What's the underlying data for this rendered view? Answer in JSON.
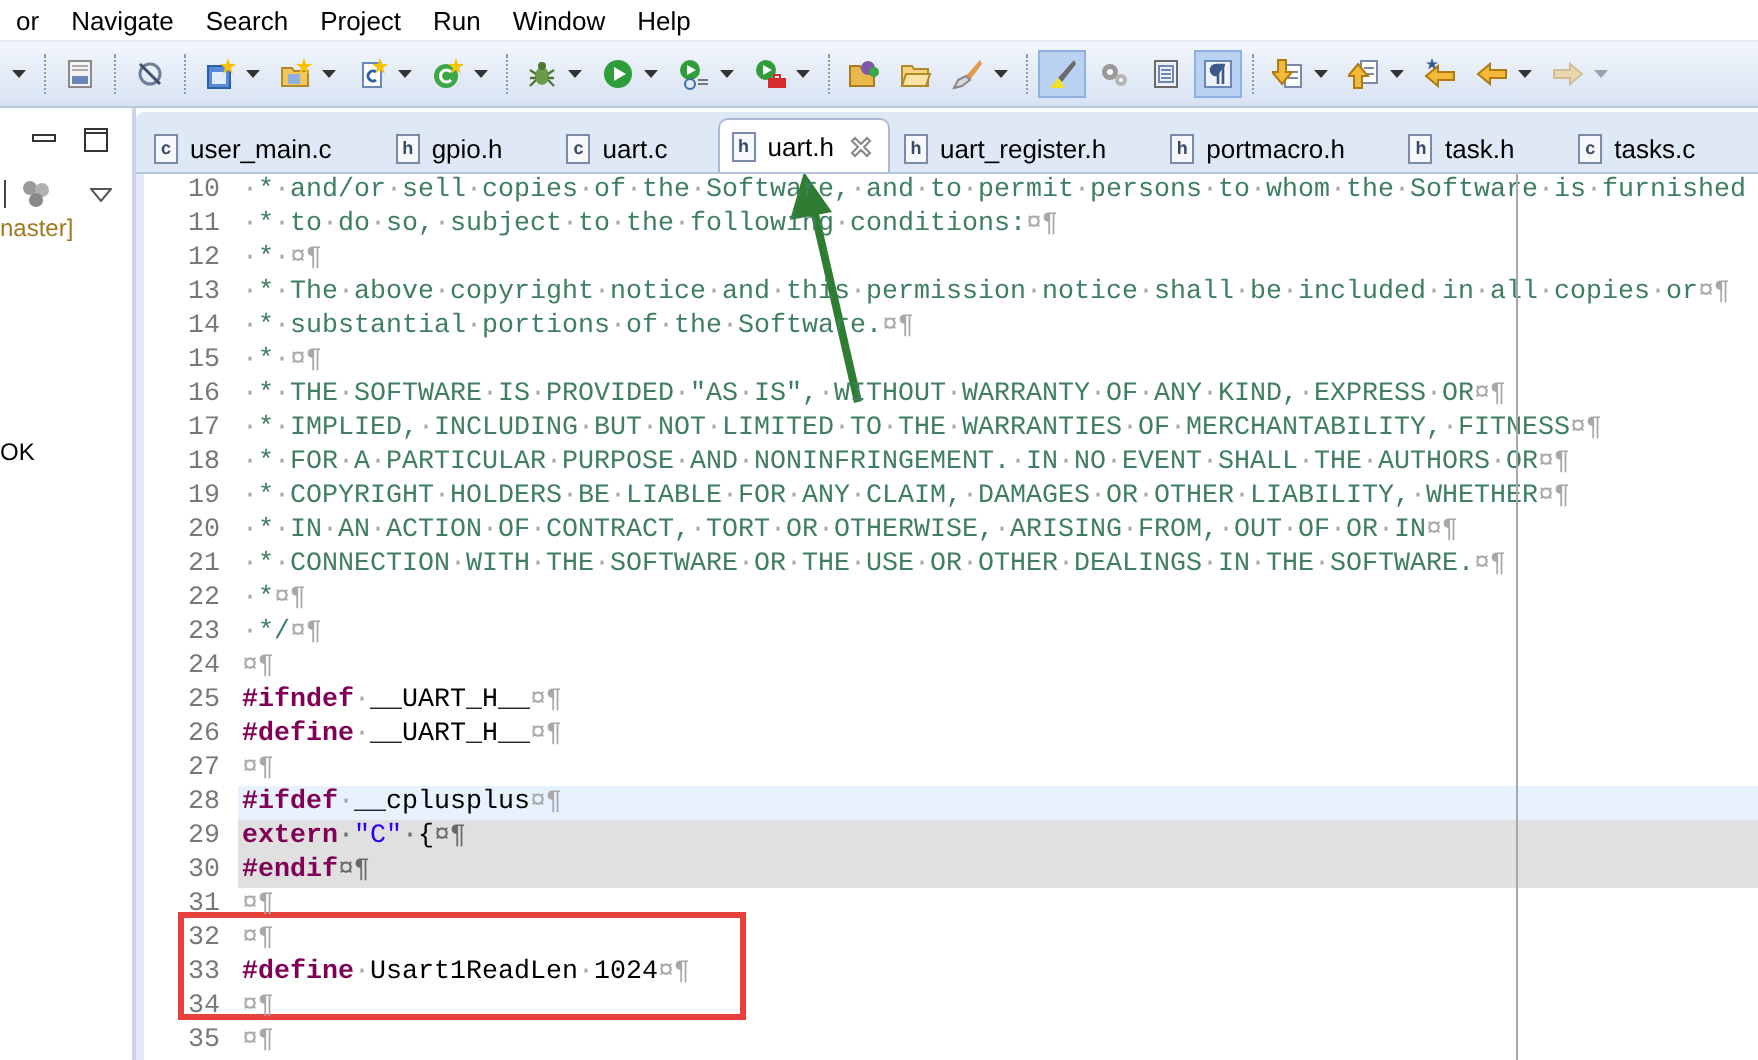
{
  "menu": [
    "or",
    "Navigate",
    "Search",
    "Project",
    "Run",
    "Window",
    "Help"
  ],
  "toolbar": [
    {
      "kind": "partial",
      "dropdown": true,
      "on": false,
      "disabled": false
    },
    {
      "kind": "sep"
    },
    {
      "kind": "binary",
      "dropdown": false,
      "on": false,
      "disabled": false
    },
    {
      "kind": "sep"
    },
    {
      "kind": "skip",
      "dropdown": false,
      "on": false,
      "disabled": false
    },
    {
      "kind": "sep"
    },
    {
      "kind": "newproject",
      "dropdown": true,
      "on": false,
      "disabled": false
    },
    {
      "kind": "newfolder",
      "dropdown": true,
      "on": false,
      "disabled": false
    },
    {
      "kind": "newfile",
      "dropdown": true,
      "on": false,
      "disabled": false
    },
    {
      "kind": "newclass",
      "dropdown": true,
      "on": false,
      "disabled": false
    },
    {
      "kind": "sep"
    },
    {
      "kind": "debug",
      "dropdown": true,
      "on": false,
      "disabled": false
    },
    {
      "kind": "run",
      "dropdown": true,
      "on": false,
      "disabled": false
    },
    {
      "kind": "coverage",
      "dropdown": true,
      "on": false,
      "disabled": false
    },
    {
      "kind": "tools",
      "dropdown": true,
      "on": false,
      "disabled": false
    },
    {
      "kind": "sep"
    },
    {
      "kind": "openfolder",
      "dropdown": false,
      "on": false,
      "disabled": false
    },
    {
      "kind": "folder",
      "dropdown": false,
      "on": false,
      "disabled": false
    },
    {
      "kind": "brush",
      "dropdown": true,
      "on": false,
      "disabled": false
    },
    {
      "kind": "sep"
    },
    {
      "kind": "highlight",
      "dropdown": false,
      "on": true,
      "disabled": false
    },
    {
      "kind": "blocks",
      "dropdown": false,
      "on": false,
      "disabled": false
    },
    {
      "kind": "outline",
      "dropdown": false,
      "on": false,
      "disabled": false
    },
    {
      "kind": "whitespace",
      "dropdown": false,
      "on": true,
      "disabled": false
    },
    {
      "kind": "sep"
    },
    {
      "kind": "nextann",
      "dropdown": true,
      "on": false,
      "disabled": false
    },
    {
      "kind": "prevann",
      "dropdown": true,
      "on": false,
      "disabled": false
    },
    {
      "kind": "lastedit",
      "dropdown": false,
      "on": false,
      "disabled": false
    },
    {
      "kind": "back",
      "dropdown": true,
      "on": false,
      "disabled": false
    },
    {
      "kind": "forward",
      "dropdown": true,
      "on": false,
      "disabled": true
    }
  ],
  "left_panel": {
    "texts": [
      {
        "kind": "branch",
        "text": "naster]"
      },
      {
        "kind": "plain",
        "text": "OK"
      }
    ]
  },
  "tabs": [
    {
      "icon_text": "c",
      "label": "user_main.c",
      "selected": false
    },
    {
      "icon_text": "h",
      "label": "gpio.h",
      "selected": false
    },
    {
      "icon_text": "c",
      "label": "uart.c",
      "selected": false
    },
    {
      "icon_text": "h",
      "label": "uart.h",
      "selected": true
    },
    {
      "icon_text": "h",
      "label": "uart_register.h",
      "selected": false
    },
    {
      "icon_text": "h",
      "label": "portmacro.h",
      "selected": false
    },
    {
      "icon_text": "h",
      "label": "task.h",
      "selected": false
    },
    {
      "icon_text": "c",
      "label": "tasks.c",
      "selected": false
    }
  ],
  "editor": {
    "lines": [
      {
        "number": "10",
        "current": false,
        "inactive": false,
        "segments": [
          {
            "kind": "comment",
            "text": "·*·and/or·sell·copies·of·the·Software,·and·to·permit·persons·to·whom·the·Software·is·furnished"
          }
        ]
      },
      {
        "number": "11",
        "current": false,
        "inactive": false,
        "segments": [
          {
            "kind": "comment",
            "text": "·*·to·do·so,·subject·to·the·following·conditions:¤¶"
          }
        ]
      },
      {
        "number": "12",
        "current": false,
        "inactive": false,
        "segments": [
          {
            "kind": "comment",
            "text": "·*·¤¶"
          }
        ]
      },
      {
        "number": "13",
        "current": false,
        "inactive": false,
        "segments": [
          {
            "kind": "comment",
            "text": "·*·The·above·copyright·notice·and·this·permission·notice·shall·be·included·in·all·copies·or¤¶"
          }
        ]
      },
      {
        "number": "14",
        "current": false,
        "inactive": false,
        "segments": [
          {
            "kind": "comment",
            "text": "·*·substantial·portions·of·the·Software.¤¶"
          }
        ]
      },
      {
        "number": "15",
        "current": false,
        "inactive": false,
        "segments": [
          {
            "kind": "comment",
            "text": "·*·¤¶"
          }
        ]
      },
      {
        "number": "16",
        "current": false,
        "inactive": false,
        "segments": [
          {
            "kind": "comment",
            "text": "·*·THE·SOFTWARE·IS·PROVIDED·\"AS·IS\",·WITHOUT·WARRANTY·OF·ANY·KIND,·EXPRESS·OR¤¶"
          }
        ]
      },
      {
        "number": "17",
        "current": false,
        "inactive": false,
        "segments": [
          {
            "kind": "comment",
            "text": "·*·IMPLIED,·INCLUDING·BUT·NOT·LIMITED·TO·THE·WARRANTIES·OF·MERCHANTABILITY,·FITNESS¤¶"
          }
        ]
      },
      {
        "number": "18",
        "current": false,
        "inactive": false,
        "segments": [
          {
            "kind": "comment",
            "text": "·*·FOR·A·PARTICULAR·PURPOSE·AND·NONINFRINGEMENT.·IN·NO·EVENT·SHALL·THE·AUTHORS·OR¤¶"
          }
        ]
      },
      {
        "number": "19",
        "current": false,
        "inactive": false,
        "segments": [
          {
            "kind": "comment",
            "text": "·*·COPYRIGHT·HOLDERS·BE·LIABLE·FOR·ANY·CLAIM,·DAMAGES·OR·OTHER·LIABILITY,·WHETHER¤¶"
          }
        ]
      },
      {
        "number": "20",
        "current": false,
        "inactive": false,
        "segments": [
          {
            "kind": "comment",
            "text": "·*·IN·AN·ACTION·OF·CONTRACT,·TORT·OR·OTHERWISE,·ARISING·FROM,·OUT·OF·OR·IN¤¶"
          }
        ]
      },
      {
        "number": "21",
        "current": false,
        "inactive": false,
        "segments": [
          {
            "kind": "comment",
            "text": "·*·CONNECTION·WITH·THE·SOFTWARE·OR·THE·USE·OR·OTHER·DEALINGS·IN·THE·SOFTWARE.¤¶"
          }
        ]
      },
      {
        "number": "22",
        "current": false,
        "inactive": false,
        "segments": [
          {
            "kind": "comment",
            "text": "·*¤¶"
          }
        ]
      },
      {
        "number": "23",
        "current": false,
        "inactive": false,
        "segments": [
          {
            "kind": "comment",
            "text": "·*/¤¶"
          }
        ]
      },
      {
        "number": "24",
        "current": false,
        "inactive": false,
        "segments": [
          {
            "kind": "plain",
            "text": "¤¶"
          }
        ]
      },
      {
        "number": "25",
        "current": false,
        "inactive": false,
        "segments": [
          {
            "kind": "keyword",
            "text": "#ifndef"
          },
          {
            "kind": "plain",
            "text": "·__UART_H__¤¶"
          }
        ]
      },
      {
        "number": "26",
        "current": false,
        "inactive": false,
        "segments": [
          {
            "kind": "keyword",
            "text": "#define"
          },
          {
            "kind": "plain",
            "text": "·__UART_H__¤¶"
          }
        ]
      },
      {
        "number": "27",
        "current": false,
        "inactive": false,
        "segments": [
          {
            "kind": "plain",
            "text": "¤¶"
          }
        ]
      },
      {
        "number": "28",
        "current": true,
        "inactive": false,
        "segments": [
          {
            "kind": "keyword",
            "text": "#ifdef"
          },
          {
            "kind": "plain",
            "text": "·__cplusplus¤¶"
          }
        ]
      },
      {
        "number": "29",
        "current": false,
        "inactive": true,
        "segments": [
          {
            "kind": "keyword",
            "text": "extern"
          },
          {
            "kind": "plain",
            "text": "·"
          },
          {
            "kind": "string",
            "text": "\"C\""
          },
          {
            "kind": "plain",
            "text": "·{¤¶"
          }
        ]
      },
      {
        "number": "30",
        "current": false,
        "inactive": true,
        "segments": [
          {
            "kind": "keyword",
            "text": "#endif"
          },
          {
            "kind": "plain",
            "text": "¤¶"
          }
        ]
      },
      {
        "number": "31",
        "current": false,
        "inactive": false,
        "segments": [
          {
            "kind": "plain",
            "text": "¤¶"
          }
        ]
      },
      {
        "number": "32",
        "current": false,
        "inactive": false,
        "segments": [
          {
            "kind": "plain",
            "text": "¤¶"
          }
        ]
      },
      {
        "number": "33",
        "current": false,
        "inactive": false,
        "segments": [
          {
            "kind": "keyword",
            "text": "#define"
          },
          {
            "kind": "plain",
            "text": "·Usart1ReadLen·1024¤¶"
          }
        ]
      },
      {
        "number": "34",
        "current": false,
        "inactive": false,
        "segments": [
          {
            "kind": "plain",
            "text": "¤¶"
          }
        ]
      },
      {
        "number": "35",
        "current": false,
        "inactive": false,
        "segments": [
          {
            "kind": "plain",
            "text": "¤¶"
          }
        ]
      }
    ]
  }
}
